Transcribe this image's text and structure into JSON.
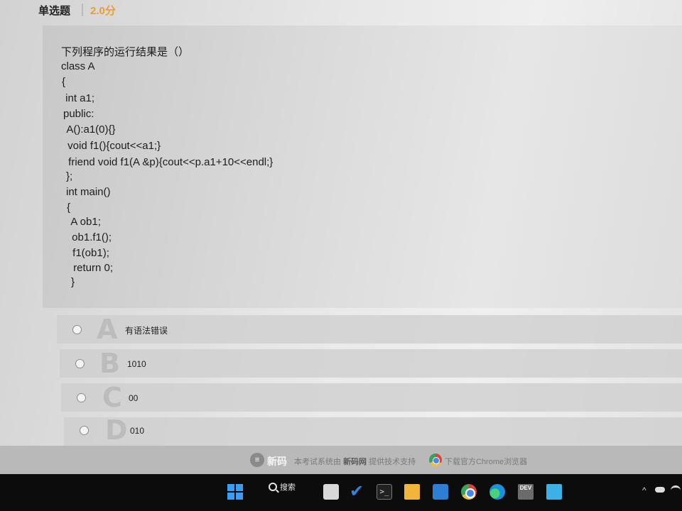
{
  "header": {
    "question_type": "单选题",
    "score": "2.0分"
  },
  "question": {
    "title": "下列程序的运行结果是（）",
    "code_lines": [
      "class A",
      "{",
      " int a1;",
      "public:",
      " A():a1(0){}",
      " void f1(){cout<<a1;}",
      " friend void f1(A &p){cout<<p.a1+10<<endl;}",
      "};",
      "int main()",
      "{",
      " A ob1;",
      " ob1.f1();",
      " f1(ob1);",
      " return 0;",
      "}"
    ]
  },
  "options": [
    {
      "letter": "A",
      "text": "有语法错误"
    },
    {
      "letter": "B",
      "text": "1010"
    },
    {
      "letter": "C",
      "text": "00"
    },
    {
      "letter": "D",
      "text": "010"
    }
  ],
  "footer": {
    "brand": "新码",
    "support_prefix": "本考试系统由",
    "support_site": "新码网",
    "support_suffix": "提供技术支持",
    "download_text": "下载官方Chrome浏览器"
  },
  "taskbar": {
    "search_label": "搜索",
    "apps": [
      "start-icon",
      "search-icon",
      "task-view-icon",
      "todo-icon",
      "terminal-icon",
      "file-explorer-icon",
      "mail-icon",
      "chrome-icon",
      "edge-icon",
      "dev-cpp-icon",
      "notepad-icon"
    ],
    "dev_label": "DEV",
    "terminal_label": ">_"
  },
  "colors": {
    "score": "#e8a02a",
    "taskbar": "#0c0c0c",
    "footer": "#b9b9b9"
  }
}
